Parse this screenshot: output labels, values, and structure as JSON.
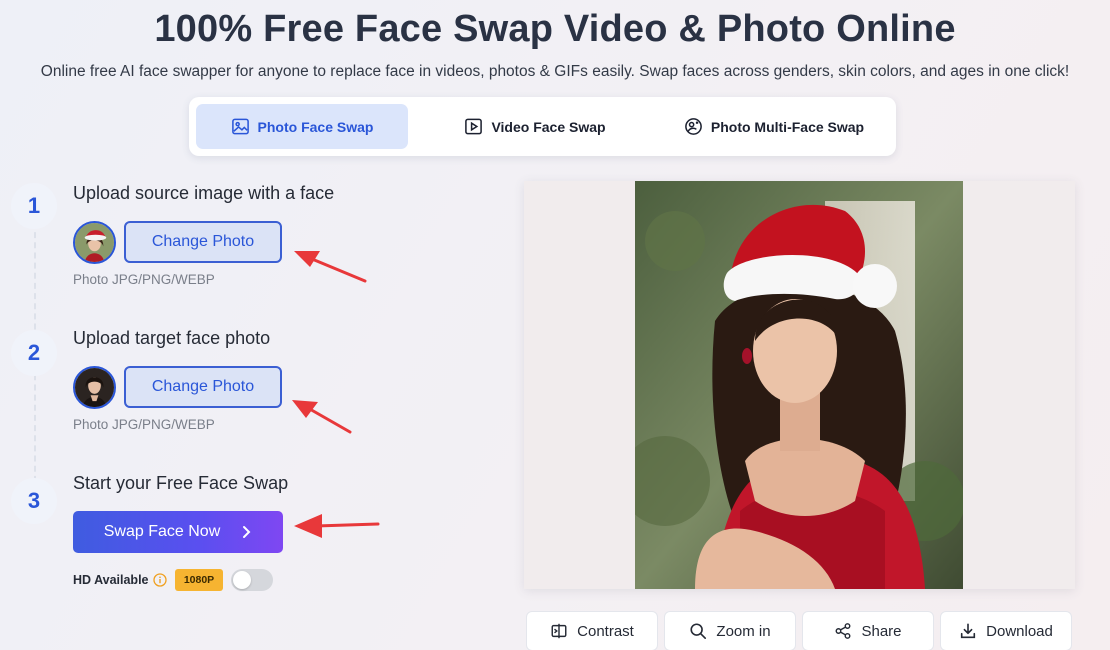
{
  "header": {
    "title": "100% Free Face Swap Video & Photo Online",
    "subtitle": "Online free AI face swapper for anyone to replace face in videos, photos & GIFs easily. Swap faces across genders, skin colors, and ages in one click!"
  },
  "tabs": [
    {
      "label": "Photo Face Swap",
      "icon": "image-icon",
      "active": true
    },
    {
      "label": "Video Face Swap",
      "icon": "play-icon",
      "active": false
    },
    {
      "label": "Photo Multi-Face Swap",
      "icon": "multi-face-icon",
      "active": false
    }
  ],
  "steps": [
    {
      "number": "1",
      "title": "Upload source image with a face",
      "button": "Change Photo",
      "formats": "Photo JPG/PNG/WEBP"
    },
    {
      "number": "2",
      "title": "Upload target face photo",
      "button": "Change Photo",
      "formats": "Photo JPG/PNG/WEBP"
    },
    {
      "number": "3",
      "title": "Start your Free Face Swap",
      "button": "Swap Face Now"
    }
  ],
  "hd": {
    "label": "HD Available",
    "badge": "1080P",
    "enabled": false
  },
  "actions": [
    {
      "label": "Contrast",
      "icon": "contrast-icon"
    },
    {
      "label": "Zoom in",
      "icon": "zoom-icon"
    },
    {
      "label": "Share",
      "icon": "share-icon"
    },
    {
      "label": "Download",
      "icon": "download-icon"
    }
  ],
  "colors": {
    "accent": "#2a56d8",
    "tab_active_bg": "#dbe5fb",
    "swap_gradient_start": "#3f5ce0",
    "swap_gradient_end": "#7f47f2",
    "badge": "#f6b431",
    "arrow": "#e8383a"
  }
}
